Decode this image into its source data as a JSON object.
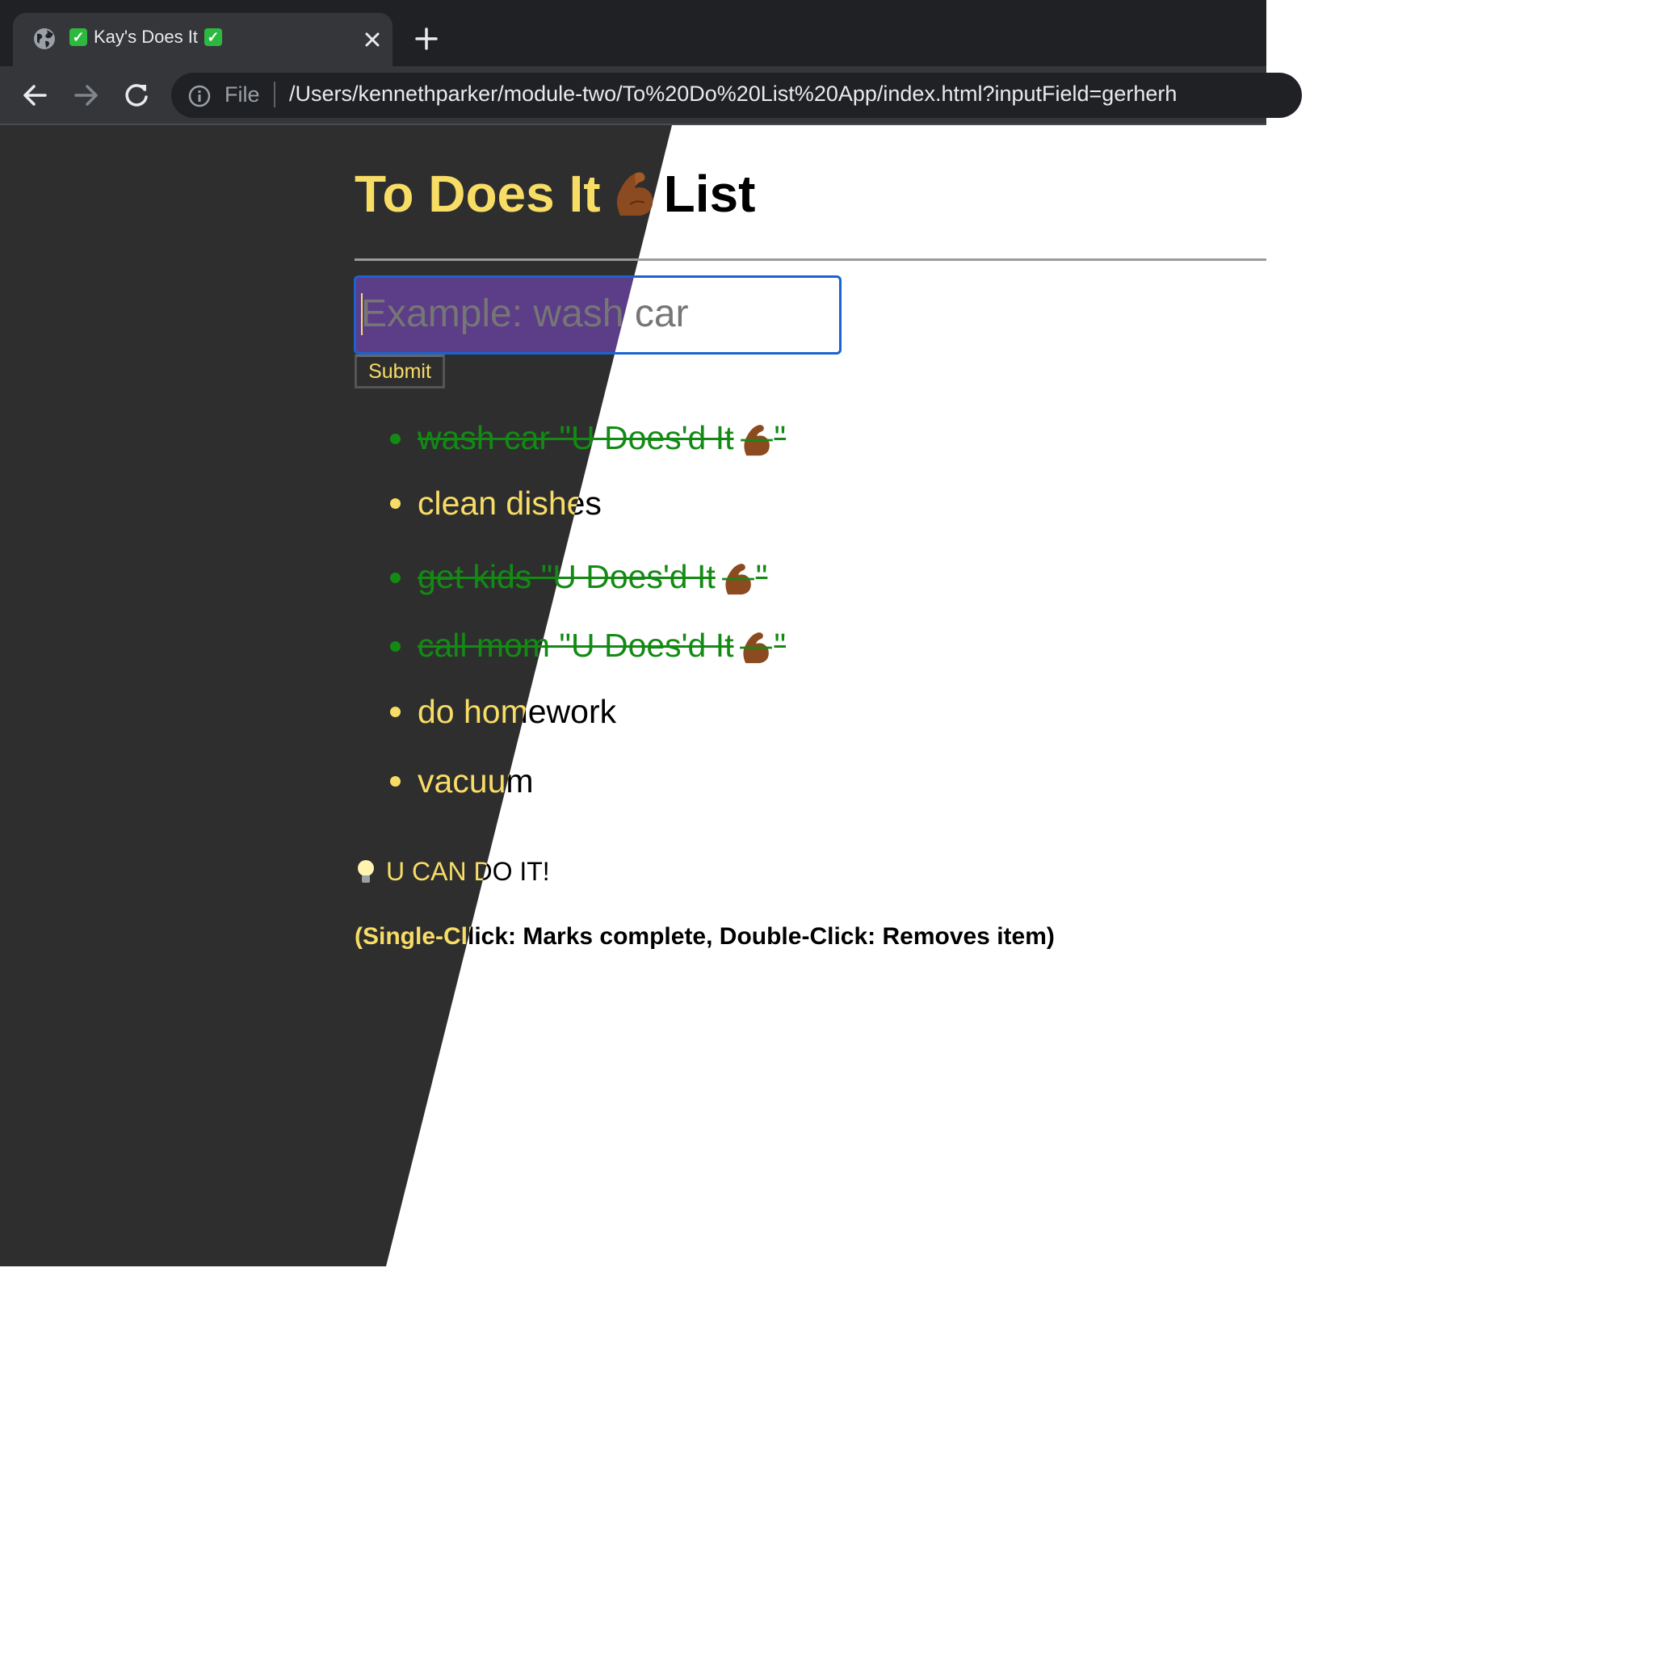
{
  "browser": {
    "tab_title": "Kay's Does It",
    "tab_check_glyph": "✓",
    "new_tab_label": "+",
    "close_glyph": "✕",
    "url_scheme_label": "File",
    "url_path": "/Users/kennethparker/module-two/To%20Do%20List%20App/index.html?inputField=gerherh",
    "colors": {
      "chrome_bg": "#202124",
      "toolbar_bg": "#35363a",
      "check_green": "#2db840"
    }
  },
  "page": {
    "title_part1": "To Does It",
    "title_part2": "List",
    "input_placeholder": "Example: wash car",
    "submit_label": "Submit",
    "items": [
      {
        "text": "wash car \"U Does'd It",
        "suffix": "\"",
        "done": true
      },
      {
        "text": "clean dishes",
        "done": false
      },
      {
        "text": "get kids \"U Does'd It",
        "suffix": "\"",
        "done": true
      },
      {
        "text": "call mom \"U Does'd It",
        "suffix": "\"",
        "done": true
      },
      {
        "text": "do homework",
        "done": false
      },
      {
        "text": "vacuum",
        "done": false
      }
    ],
    "tip": "U CAN DO IT!",
    "help": "(Single-Cllick: Marks complete, Double-Click: Removes item)",
    "colors": {
      "dark_bg": "#2e2e2f",
      "accent_yellow": "#f8dd65",
      "done_green": "#138a13",
      "input_border": "#1a63d1",
      "input_selection": "#5c3d88"
    },
    "icons": {
      "title_emoji": "flexed-biceps-icon",
      "tip_emoji": "light-bulb-icon"
    }
  }
}
